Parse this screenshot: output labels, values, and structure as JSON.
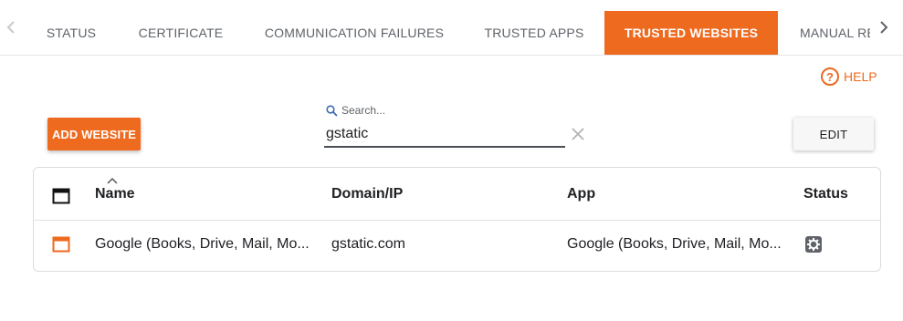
{
  "tabs": [
    {
      "label": "STATUS"
    },
    {
      "label": "CERTIFICATE"
    },
    {
      "label": "COMMUNICATION FAILURES"
    },
    {
      "label": "TRUSTED APPS"
    },
    {
      "label": "TRUSTED WEBSITES",
      "active": true
    },
    {
      "label": "MANUAL RE"
    }
  ],
  "help": {
    "label": "HELP",
    "icon": "help-circle-icon"
  },
  "toolbar": {
    "add_label": "ADD WEBSITE",
    "search_label": "Search...",
    "search_value": "gstatic",
    "edit_label": "EDIT"
  },
  "table": {
    "columns": [
      "Name",
      "Domain/IP",
      "App",
      "Status"
    ],
    "rows": [
      {
        "name": "Google (Books, Drive, Mail, Mo...",
        "domain": "gstatic.com",
        "app": "Google (Books, Drive, Mail, Mo...",
        "status_icon": "gear-icon"
      }
    ]
  },
  "colors": {
    "accent": "#ee6a1f",
    "text": "#202124",
    "muted": "#5f6368"
  }
}
